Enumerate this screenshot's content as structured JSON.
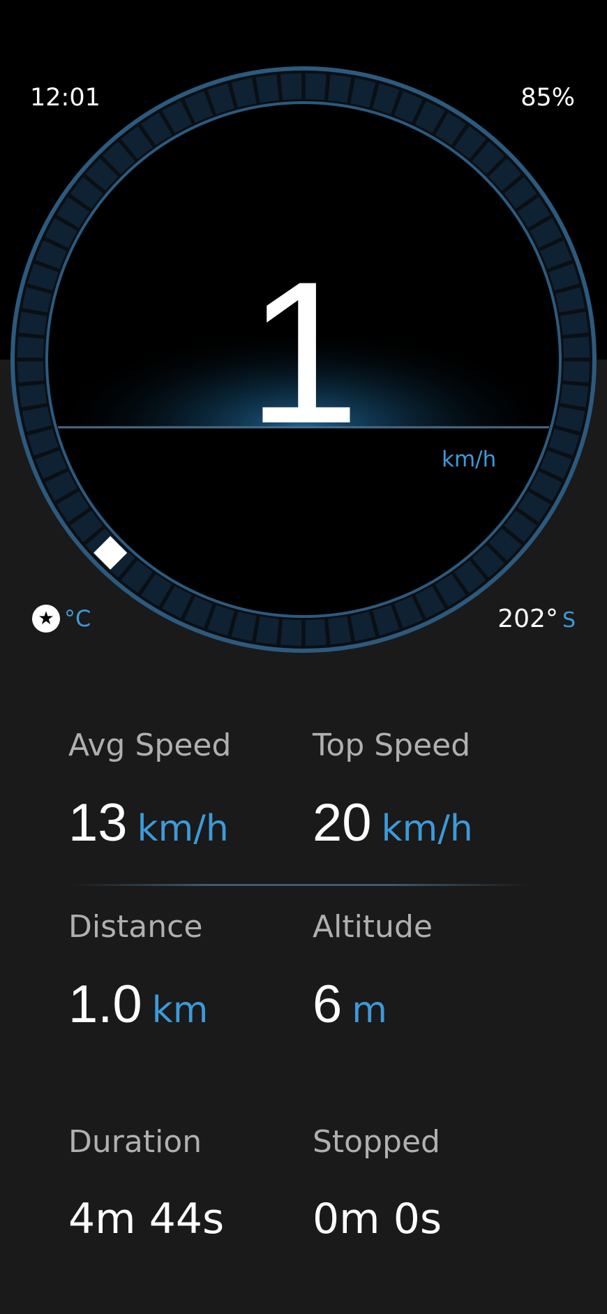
{
  "status_bar": {
    "time": "12:01",
    "battery": "85%"
  },
  "speedometer": {
    "speed": "1",
    "unit": "km/h",
    "ring_segments": 72,
    "marker_position_fraction": 0.125,
    "colors": {
      "accent": "#3d9ad9",
      "ring": "#2c5a7e",
      "segment": "#0f2233"
    }
  },
  "temperature": {
    "icon": "star-badge-icon",
    "unit": "°C"
  },
  "heading": {
    "degrees": "202°",
    "direction": "S"
  },
  "stats": {
    "avg_speed": {
      "label": "Avg Speed",
      "value": "13",
      "unit": "km/h"
    },
    "top_speed": {
      "label": "Top Speed",
      "value": "20",
      "unit": "km/h"
    },
    "distance": {
      "label": "Distance",
      "value": "1.0",
      "unit": "km"
    },
    "altitude": {
      "label": "Altitude",
      "value": "6",
      "unit": "m"
    },
    "duration": {
      "label": "Duration",
      "value": "4m 44s"
    },
    "stopped": {
      "label": "Stopped",
      "value": "0m 0s"
    }
  }
}
